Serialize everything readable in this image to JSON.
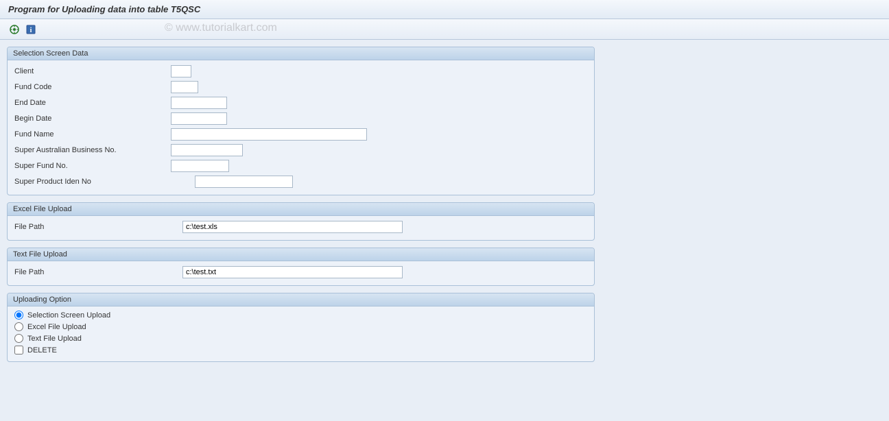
{
  "title": "Program for Uploading data into table T5QSC",
  "watermark": "© www.tutorialkart.com",
  "groups": {
    "selection": {
      "title": "Selection Screen Data",
      "fields": {
        "client": {
          "label": "Client",
          "value": ""
        },
        "fund_code": {
          "label": "Fund Code",
          "value": ""
        },
        "end_date": {
          "label": "End Date",
          "value": ""
        },
        "begin_date": {
          "label": "Begin Date",
          "value": ""
        },
        "fund_name": {
          "label": "Fund Name",
          "value": ""
        },
        "super_abn": {
          "label": "Super Australian Business No.",
          "value": ""
        },
        "super_fund_no": {
          "label": "Super Fund No.",
          "value": ""
        },
        "super_prod_id": {
          "label": "Super Product Iden No",
          "value": ""
        }
      }
    },
    "excel": {
      "title": "Excel File Upload",
      "file_path": {
        "label": "File Path",
        "value": "c:\\test.xls"
      }
    },
    "text": {
      "title": "Text File Upload",
      "file_path": {
        "label": "File Path",
        "value": "c:\\test.txt"
      }
    },
    "option": {
      "title": "Uploading Option",
      "radios": {
        "selection_upload": {
          "label": "Selection Screen Upload",
          "checked": true
        },
        "excel_upload": {
          "label": "Excel File Upload",
          "checked": false
        },
        "text_upload": {
          "label": "Text File Upload",
          "checked": false
        }
      },
      "delete": {
        "label": "DELETE",
        "checked": false
      }
    }
  }
}
